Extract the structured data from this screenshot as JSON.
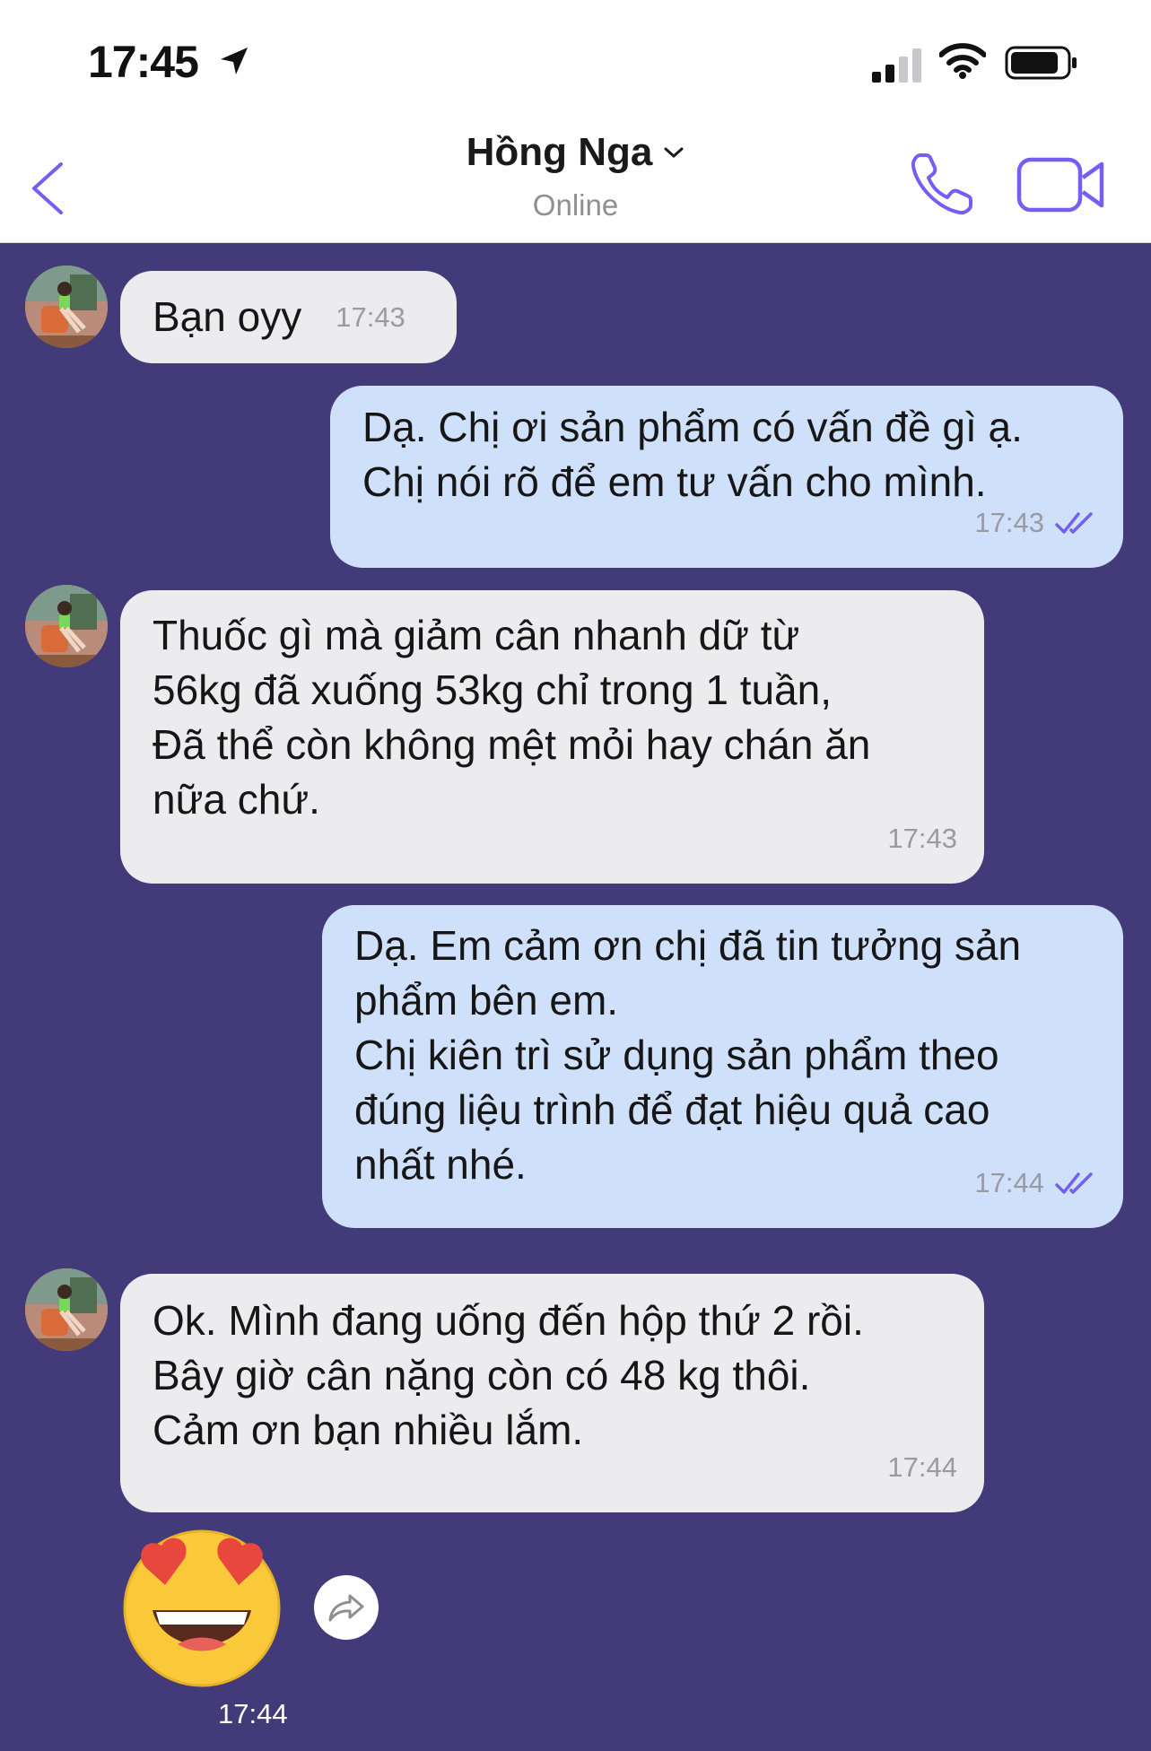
{
  "status_bar": {
    "time": "17:45"
  },
  "header": {
    "contact_name": "Hồng Nga",
    "presence": "Online"
  },
  "messages": [
    {
      "direction": "in",
      "text": "Bạn oyy",
      "time": "17:43"
    },
    {
      "direction": "out",
      "text": "Dạ. Chị ơi sản phẩm có vấn đề gì ạ.\nChị nói rõ để em tư vấn cho mình.",
      "time": "17:43"
    },
    {
      "direction": "in",
      "text": "Thuốc gì mà giảm cân nhanh dữ từ\n56kg đã xuống 53kg chỉ trong 1 tuần,\nĐã thể còn không mệt mỏi hay chán ăn\nnữa chứ.",
      "time": "17:43"
    },
    {
      "direction": "out",
      "text": "Dạ. Em cảm ơn chị đã tin tưởng sản\nphẩm bên em.\nChị kiên trì sử dụng sản phẩm theo\nđúng liệu trình để đạt hiệu quả cao\nnhất nhé.",
      "time": "17:44"
    },
    {
      "direction": "in",
      "text": "Ok. Mình đang uống đến hộp thứ 2 rồi.\nBây giờ cân nặng còn có 48 kg thôi.\nCảm ơn bạn nhiều lắm.",
      "time": "17:44"
    }
  ],
  "sticker": {
    "icon": "heart-eyes-emoji",
    "time": "17:44"
  },
  "colors": {
    "chat_background": "#433a79",
    "incoming_bubble": "#ececee",
    "outgoing_bubble": "#cfe0fb",
    "accent": "#7360f2"
  }
}
